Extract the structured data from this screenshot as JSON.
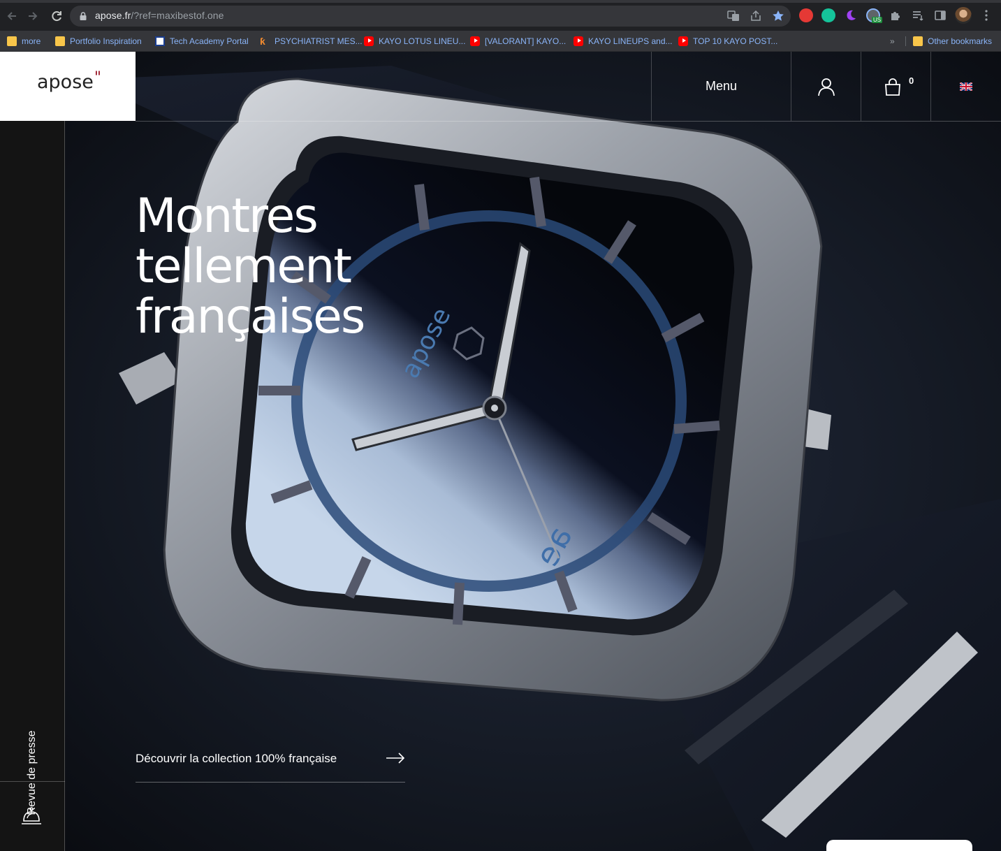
{
  "browser": {
    "url_domain": "apose.fr",
    "url_path": "/?ref=maxibestof.one",
    "profile_badge": "US",
    "bookmarks": [
      {
        "label": "more",
        "type": "folder"
      },
      {
        "label": "Portfolio Inspiration",
        "type": "folder"
      },
      {
        "label": "Tech Academy Portal",
        "type": "site"
      },
      {
        "label": "PSYCHIATRIST MES...",
        "type": "site"
      },
      {
        "label": "KAYO LOTUS LINEU...",
        "type": "youtube"
      },
      {
        "label": "[VALORANT] KAYO...",
        "type": "youtube"
      },
      {
        "label": "KAYO LINEUPS and...",
        "type": "youtube"
      },
      {
        "label": "TOP 10 KAYO POST...",
        "type": "youtube"
      }
    ],
    "overflow_label": "»",
    "other_bookmarks": "Other bookmarks"
  },
  "site": {
    "logo_text": "apose",
    "logo_mark": "\"",
    "header": {
      "menu_label": "Menu",
      "cart_count": "0",
      "language": "EN"
    },
    "sidebar": {
      "press_label": "Revue de presse"
    },
    "hero": {
      "headline_lines": [
        "Montres",
        "tellement",
        "françaises"
      ],
      "cta_label": "Découvrir la collection 100% française",
      "watch_dial_brand": "apose",
      "watch_dial_monogram": "ae"
    }
  },
  "colors": {
    "chrome_bg": "#202124",
    "omnibox_bg": "#35363a",
    "bookmark_text": "#8ab4f8",
    "site_bg": "#171717",
    "logo_accent": "#9b1a2a",
    "dial_blue": "#2a4a78"
  }
}
